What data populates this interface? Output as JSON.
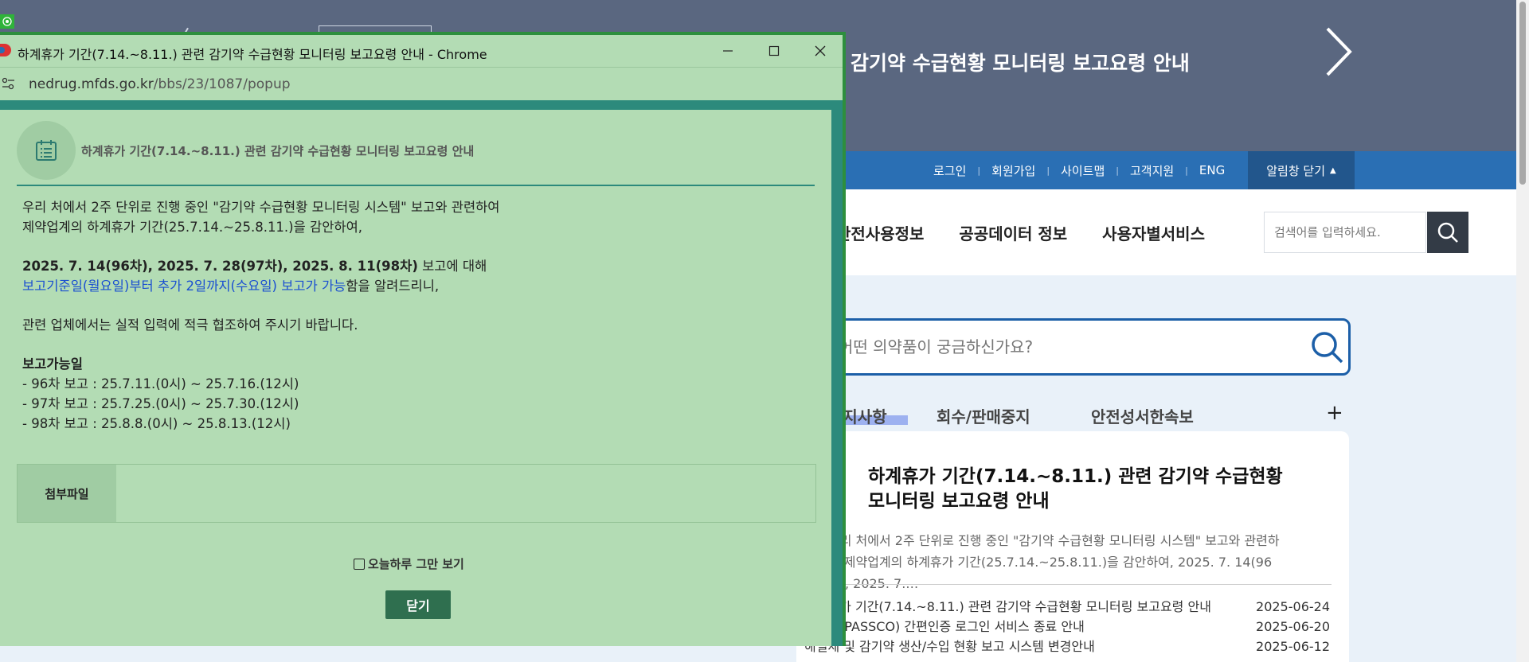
{
  "site": {
    "banner_title": "감기약 수급현황 모니터링 보고요령 안내",
    "util_links": [
      "로그인",
      "회원가입",
      "사이트맵",
      "고객지원",
      "ENG"
    ],
    "alarm_close": "알림창 닫기",
    "gnb_menu": [
      "안전사용정보",
      "공공데이터 정보",
      "사용자별서비스"
    ],
    "search_placeholder": "검색어를 입력하세요.",
    "main_search_placeholder": "어떤 의약품이 궁금하신가요?",
    "tabs": [
      "공지사항",
      "회수/판매중지",
      "안전성서한속보"
    ],
    "card": {
      "title": "하계휴가 기간(7.14.~8.11.) 관련 감기약 수급현황 모니터링 보고요령 안내",
      "summary": "우리 처에서 2주 단위로 진행 중인 \"감기약 수급현황 모니터링 시스템\" 보고와 관련하여 제약업계의 하계휴가 기간(25.7.14.~25.8.11.)을 감안하여,   2025. 7. 14(96차), 2025. 7.…"
    },
    "news": [
      {
        "title": "하계휴가 기간(7.14.~8.11.) 관련 감기약 수급현황 모니터링 보고요령 안내",
        "date": "2025-06-24"
      },
      {
        "title": "범부처(PASSCO) 간편인증 로그인 서비스 종료 안내",
        "date": "2025-06-20"
      },
      {
        "title": "해열제 및 감기약 생산/수입 현황 보고 시스템 변경안내",
        "date": "2025-06-12"
      }
    ]
  },
  "popup": {
    "window_title": "하계휴가 기간(7.14.~8.11.) 관련 감기약 수급현황 모니터링 보고요령 안내 - Chrome",
    "url_domain": "nedrug.mfds.go.kr",
    "url_path": "/bbs/23/1087/popup",
    "heading": "하계휴가 기간(7.14.~8.11.) 관련 감기약 수급현황 모니터링 보고요령 안내",
    "line1": "우리 처에서 2주 단위로 진행 중인 \"감기약 수급현황 모니터링 시스템\" 보고와 관련하여",
    "line2": "제약업계의 하계휴가 기간(25.7.14.~25.8.11.)을 감안하여,",
    "dates_bold": "2025. 7. 14(96차), 2025. 7. 28(97차), 2025. 8. 11(98차)",
    "dates_suffix": " 보고에 대해",
    "blue_text": "보고기준일(월요일)부터 추가 2일까지(수요일) 보고가 가능",
    "blue_suffix": "함을 알려드리니,",
    "line_cooperate": "관련 업체에서는 실적 입력에 적극 협조하여 주시기 바랍니다.",
    "available_heading": "보고가능일",
    "available": [
      "- 96차 보고 : 25.7.11.(0시) ~ 25.7.16.(12시)",
      "- 97차 보고 : 25.7.25.(0시) ~ 25.7.30.(12시)",
      "- 98차 보고 : 25.8.8.(0시) ~ 25.8.13.(12시)"
    ],
    "attach_label": "첨부파일",
    "dont_show": "오늘하루 그만 보기",
    "close_label": "닫기"
  }
}
